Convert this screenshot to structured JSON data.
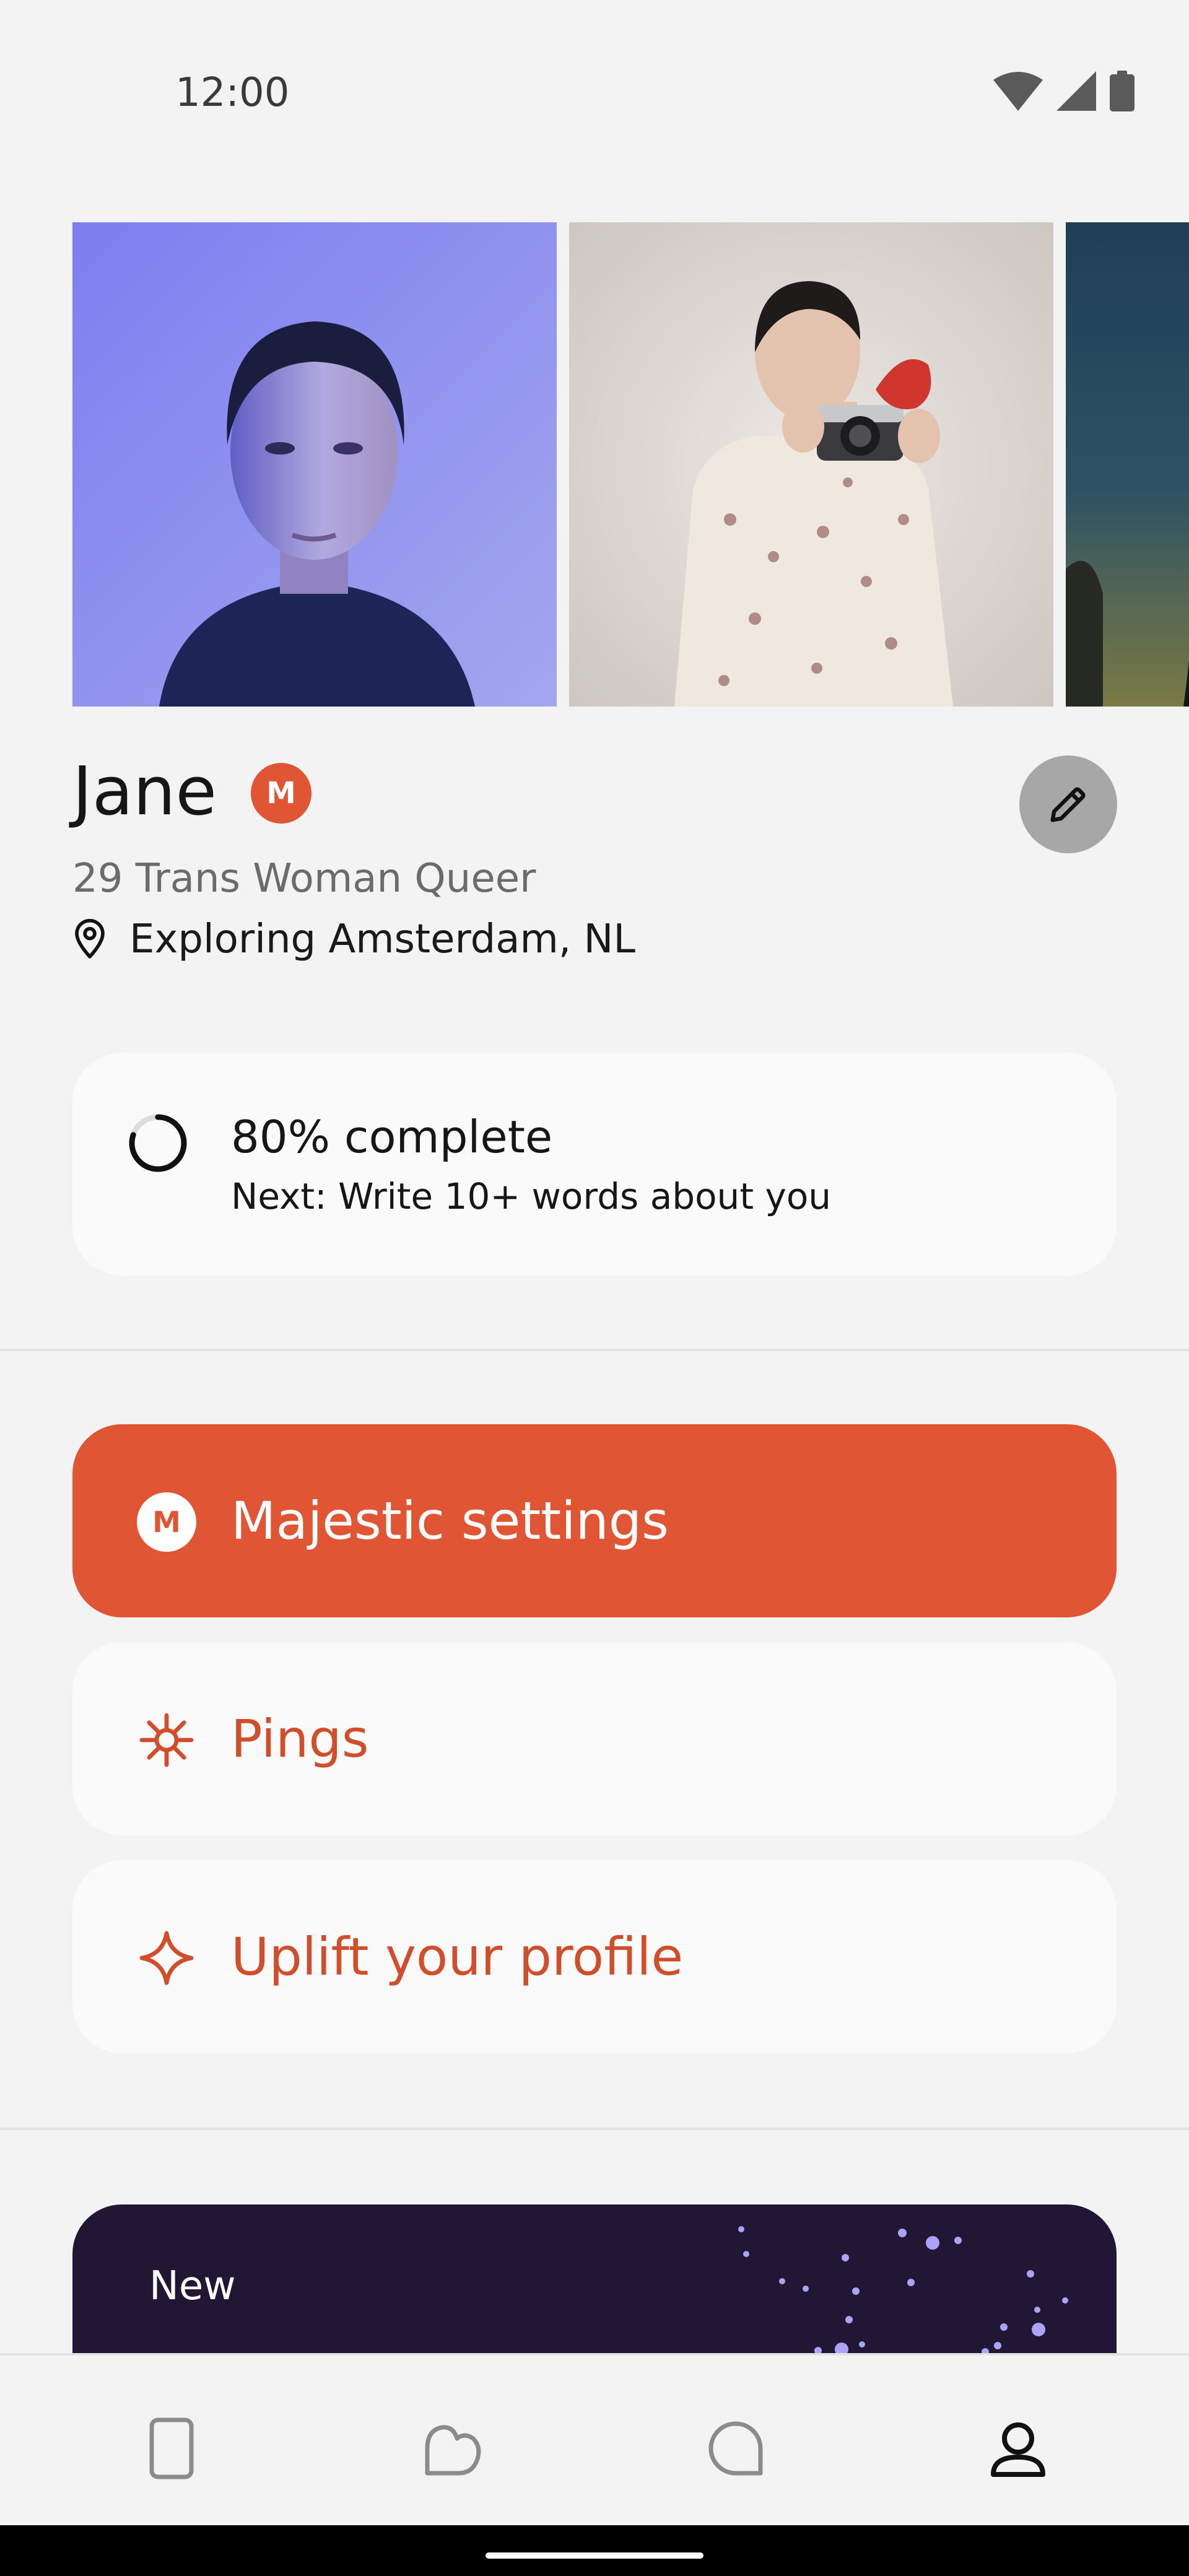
{
  "status_bar": {
    "time": "12:00",
    "icons": [
      "wifi-icon",
      "cell-signal-icon",
      "battery-icon"
    ]
  },
  "photos": [
    {
      "name": "portrait-blue-light"
    },
    {
      "name": "woman-with-camera"
    },
    {
      "name": "partial-photo"
    }
  ],
  "profile": {
    "name": "Jane",
    "badge": "M",
    "meta": "29 Trans Woman Queer",
    "location": "Exploring Amsterdam, NL"
  },
  "completion": {
    "title": "80% complete",
    "next": "Next: Write 10+ words about you",
    "progress": 0.8
  },
  "actions": {
    "majestic": {
      "label": "Majestic settings",
      "badge": "M"
    },
    "pings": {
      "label": "Pings"
    },
    "uplift": {
      "label": "Uplift your profile"
    }
  },
  "banner": {
    "label": "New"
  },
  "bottom_nav": {
    "items": [
      "cards-icon",
      "likes-icon",
      "chats-icon",
      "profile-icon"
    ],
    "active": "profile-icon"
  },
  "colors": {
    "accent": "#e05533",
    "accent_text": "#d14e2c",
    "background": "#f3f3f3",
    "card": "#fafafa",
    "banner": "#211735"
  }
}
